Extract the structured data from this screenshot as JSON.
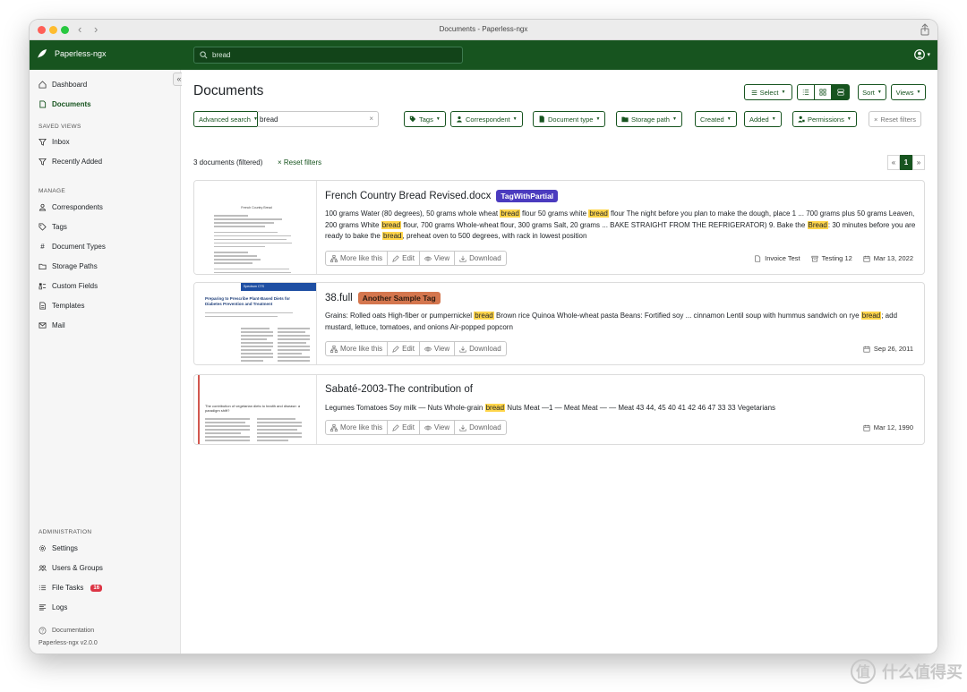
{
  "window": {
    "title": "Documents - Paperless-ngx"
  },
  "app": {
    "brand": "Paperless-ngx",
    "search_value": "bread",
    "colors": {
      "primary": "#17541f",
      "highlight": "#ffd54a",
      "danger": "#dc3545"
    }
  },
  "sidebar": {
    "nav": [
      "Dashboard",
      "Documents"
    ],
    "saved_views_header": "SAVED VIEWS",
    "saved_views": [
      "Inbox",
      "Recently Added"
    ],
    "manage_header": "MANAGE",
    "manage": [
      "Correspondents",
      "Tags",
      "Document Types",
      "Storage Paths",
      "Custom Fields",
      "Templates",
      "Mail"
    ],
    "admin_header": "ADMINISTRATION",
    "admin": [
      "Settings",
      "Users & Groups",
      "File Tasks",
      "Logs"
    ],
    "file_tasks_badge": "16",
    "documentation": "Documentation",
    "version": "Paperless-ngx v2.0.0",
    "collapse": "«"
  },
  "header": {
    "title": "Documents",
    "select": "Select",
    "sort": "Sort",
    "views": "Views"
  },
  "filters": {
    "advanced_search": "Advanced search",
    "query": "bread",
    "clear": "×",
    "tags": "Tags",
    "correspondent": "Correspondent",
    "document_type": "Document type",
    "storage_path": "Storage path",
    "created": "Created",
    "added": "Added",
    "permissions": "Permissions",
    "reset": "Reset filters"
  },
  "summary": {
    "count_text": "3 documents (filtered)",
    "reset_link": "Reset filters"
  },
  "pager": {
    "prev": "«",
    "current": "1",
    "next": "»"
  },
  "actions": {
    "more_like": "More like this",
    "edit": "Edit",
    "view": "View",
    "download": "Download"
  },
  "documents": [
    {
      "title": "French Country Bread Revised.docx",
      "tag": {
        "label": "TagWithPartial",
        "color": "#4b3bbf"
      },
      "content_1": "100 grams Water (80 degrees), 50 grams whole wheat ",
      "hl_1": "bread",
      "content_2": " flour 50 grams white ",
      "hl_2": "bread",
      "content_3": " flour The night before you plan to make the dough, place 1 ... 700 grams plus 50 grams Leaven, 200 grams White ",
      "hl_3": "bread",
      "content_4": " flour, 700 grams Whole-wheat flour, 300 grams Salt, 20 grams ... BAKE STRAIGHT FROM THE REFRIGERATOR) 9. Bake the ",
      "hl_4": "Bread",
      "content_5": ": 30 minutes before you are ready to bake the ",
      "hl_5": "bread",
      "content_6": ", preheat oven to 500 degrees, with rack in lowest position",
      "doc_type": "Invoice Test",
      "storage": "Testing 12",
      "date": "Mar 13, 2022",
      "thumb_title": "French Country Bread"
    },
    {
      "title": "38.full",
      "tag": {
        "label": "Another Sample Tag",
        "color": "#d4764e"
      },
      "content_1": "Grains: Rolled oats High-fiber or pumpernickel ",
      "hl_1": "bread",
      "content_2": " Brown rice Quinoa Whole-wheat pasta Beans: Fortified soy ... cinnamon Lentil soup with hummus sandwich on rye ",
      "hl_2": "bread",
      "content_3": "; add mustard, lettuce, tomatoes, and onions Air-popped popcorn",
      "date": "Sep 26, 2011",
      "thumb_title": "Preparing to Prescribe Plant-Based Diets for Diabetes Prevention and Treatment",
      "thumb_header": "Spectrum CTS"
    },
    {
      "title": "Sabaté-2003-The contribution of",
      "content_1": "Legumes Tomatoes Soy milk — Nuts Whole-grain ",
      "hl_1": "bread",
      "content_2": " Nuts Meat —1 — Meat Meat — — Meat 43 44, 45 40 41 42 46 47 33 33 Vegetarians",
      "date": "Mar 12, 1990",
      "thumb_title": "The contribution of vegetarian diets to health and disease: a paradigm shift?"
    }
  ],
  "watermark": "什么值得买"
}
